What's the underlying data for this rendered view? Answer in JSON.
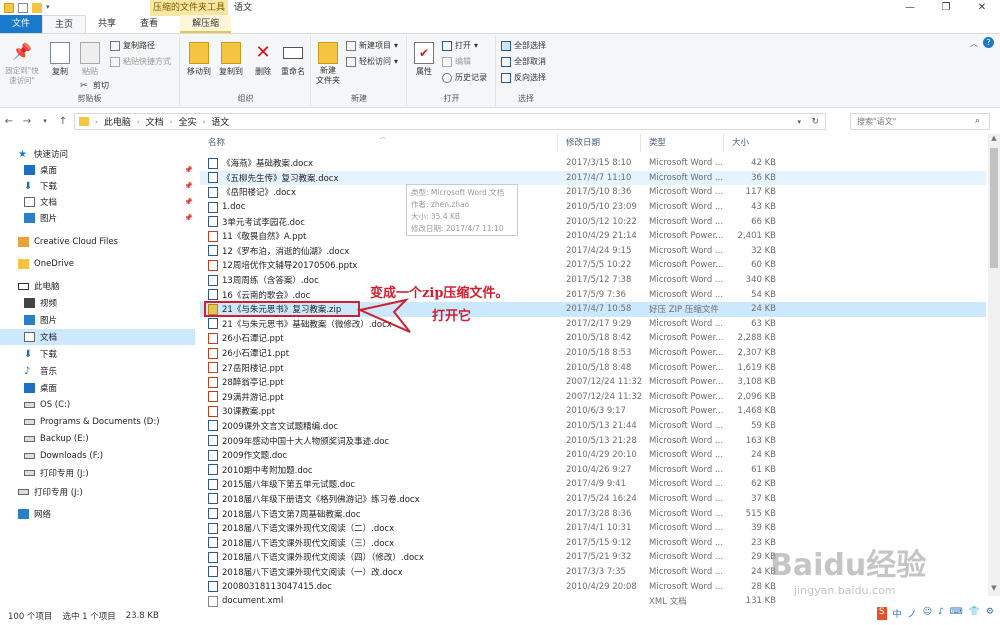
{
  "window": {
    "title": "语文",
    "context_group": "压缩的文件夹工具"
  },
  "tabs": [
    {
      "label": "文件"
    },
    {
      "label": "主页"
    },
    {
      "label": "共享"
    },
    {
      "label": "查看"
    },
    {
      "label": "解压缩"
    }
  ],
  "ribbon": {
    "clipboard": {
      "label": "剪贴板",
      "pin": "固定到\"快速访问\"",
      "copy": "复制",
      "paste": "粘贴",
      "copy_path": "复制路径",
      "paste_shortcut": "粘贴快捷方式",
      "cut": "剪切"
    },
    "organize": {
      "label": "组织",
      "move_to": "移动到",
      "copy_to": "复制到",
      "delete": "删除",
      "rename": "重命名"
    },
    "new": {
      "label": "新建",
      "new_folder": "新建\n文件夹",
      "new_item": "新建项目",
      "easy_access": "轻松访问"
    },
    "open": {
      "label": "打开",
      "properties": "属性",
      "open": "打开",
      "edit": "编辑",
      "history": "历史记录"
    },
    "select": {
      "label": "选择",
      "select_all": "全部选择",
      "select_none": "全部取消",
      "invert": "反向选择"
    }
  },
  "address": {
    "crumbs": [
      "此电脑",
      "文档",
      "全实",
      "语文"
    ],
    "search_placeholder": "搜索\"语文\""
  },
  "nav": [
    {
      "label": "快速访问",
      "icon": "star-icon",
      "pinned": false
    },
    {
      "label": "桌面",
      "icon": "desktop-icon",
      "pinned": true
    },
    {
      "label": "下载",
      "icon": "download-icon",
      "pinned": true
    },
    {
      "label": "文档",
      "icon": "documents-icon",
      "pinned": true
    },
    {
      "label": "图片",
      "icon": "pictures-icon",
      "pinned": true
    },
    {
      "label": "Creative Cloud Files",
      "icon": "creative-cloud-icon",
      "pinned": false
    },
    {
      "label": "OneDrive",
      "icon": "onedrive-icon",
      "pinned": false
    },
    {
      "label": "此电脑",
      "icon": "computer-icon",
      "pinned": false
    },
    {
      "label": "视频",
      "icon": "videos-icon",
      "pinned": false
    },
    {
      "label": "图片",
      "icon": "pictures-icon",
      "pinned": false
    },
    {
      "label": "文档",
      "icon": "documents-icon",
      "pinned": false
    },
    {
      "label": "下载",
      "icon": "download-icon",
      "pinned": false
    },
    {
      "label": "音乐",
      "icon": "music-icon",
      "pinned": false
    },
    {
      "label": "桌面",
      "icon": "desktop-icon",
      "pinned": false
    },
    {
      "label": "OS (C:)",
      "icon": "drive-icon",
      "pinned": false
    },
    {
      "label": "Programs & Documents (D:)",
      "icon": "drive-icon",
      "pinned": false
    },
    {
      "label": "Backup (E:)",
      "icon": "drive-icon",
      "pinned": false
    },
    {
      "label": "Downloads (F:)",
      "icon": "drive-icon",
      "pinned": false
    },
    {
      "label": "打印专用 (J:)",
      "icon": "drive-icon",
      "pinned": false
    },
    {
      "label": "打印专用 (J:)",
      "icon": "drive-icon",
      "pinned": false
    },
    {
      "label": "网络",
      "icon": "network-icon",
      "pinned": false
    }
  ],
  "columns": {
    "name": "名称",
    "date": "修改日期",
    "type": "类型",
    "size": "大小"
  },
  "files": [
    {
      "name": "《海燕》基础教案.docx",
      "date": "2017/3/15 8:10",
      "type": "Microsoft Word ...",
      "size": "42 KB",
      "kind": "doc"
    },
    {
      "name": "《五柳先生传》复习教案.docx",
      "date": "2017/4/7 11:10",
      "type": "Microsoft Word ...",
      "size": "36 KB",
      "kind": "doc"
    },
    {
      "name": "《岳阳楼记》.docx",
      "date": "2017/5/10 8:36",
      "type": "Microsoft Word ...",
      "size": "117 KB",
      "kind": "doc"
    },
    {
      "name": "1.doc",
      "date": "2010/5/10 23:09",
      "type": "Microsoft Word ...",
      "size": "43 KB",
      "kind": "doc"
    },
    {
      "name": "3单元考试李园花.doc",
      "date": "2010/5/12 10:22",
      "type": "Microsoft Word ...",
      "size": "66 KB",
      "kind": "doc"
    },
    {
      "name": "11《敬畏自然》A.ppt",
      "date": "2010/4/29 21:14",
      "type": "Microsoft Power...",
      "size": "2,401 KB",
      "kind": "ppt"
    },
    {
      "name": "12《罗布泊，消逝的仙湖》.docx",
      "date": "2017/4/24 9:15",
      "type": "Microsoft Word ...",
      "size": "32 KB",
      "kind": "doc"
    },
    {
      "name": "12周培优作文辅导20170506.pptx",
      "date": "2017/5/5 10:22",
      "type": "Microsoft Power...",
      "size": "60 KB",
      "kind": "ppt"
    },
    {
      "name": "13周周练（含答案）.doc",
      "date": "2017/5/12 7:38",
      "type": "Microsoft Word ...",
      "size": "340 KB",
      "kind": "doc"
    },
    {
      "name": "16《云南的歌会》.doc",
      "date": "2017/5/9 7:36",
      "type": "Microsoft Word ...",
      "size": "54 KB",
      "kind": "doc"
    },
    {
      "name": "21《与朱元思书》复习教案.zip",
      "date": "2017/4/7 10:58",
      "type": "好压 ZIP 压缩文件",
      "size": "24 KB",
      "kind": "zip"
    },
    {
      "name": "21《与朱元思书》基础教案（微修改）.docx",
      "date": "2017/2/17 9:29",
      "type": "Microsoft Word ...",
      "size": "63 KB",
      "kind": "doc"
    },
    {
      "name": "26小石潭记.ppt",
      "date": "2010/5/18 8:42",
      "type": "Microsoft Power...",
      "size": "2,288 KB",
      "kind": "ppt"
    },
    {
      "name": "26小石潭记1.ppt",
      "date": "2010/5/18 8:53",
      "type": "Microsoft Power...",
      "size": "2,307 KB",
      "kind": "ppt"
    },
    {
      "name": "27岳阳楼记.ppt",
      "date": "2010/5/18 8:48",
      "type": "Microsoft Power...",
      "size": "1,619 KB",
      "kind": "ppt"
    },
    {
      "name": "28醉翁亭记.ppt",
      "date": "2007/12/24 11:32",
      "type": "Microsoft Power...",
      "size": "3,108 KB",
      "kind": "ppt"
    },
    {
      "name": "29满井游记.ppt",
      "date": "2007/12/24 11:32",
      "type": "Microsoft Power...",
      "size": "2,096 KB",
      "kind": "ppt"
    },
    {
      "name": "30课教案.ppt",
      "date": "2010/6/3 9:17",
      "type": "Microsoft Power...",
      "size": "1,468 KB",
      "kind": "ppt"
    },
    {
      "name": "2009课外文言文试题精编.doc",
      "date": "2010/5/13 21:44",
      "type": "Microsoft Word ...",
      "size": "59 KB",
      "kind": "doc"
    },
    {
      "name": "2009年感动中国十大人物颁奖词及事迹.doc",
      "date": "2010/5/13 21:28",
      "type": "Microsoft Word ...",
      "size": "163 KB",
      "kind": "doc"
    },
    {
      "name": "2009作文题.doc",
      "date": "2010/4/29 20:10",
      "type": "Microsoft Word ...",
      "size": "24 KB",
      "kind": "doc"
    },
    {
      "name": "2010期中考附加题.doc",
      "date": "2010/4/26 9:27",
      "type": "Microsoft Word ...",
      "size": "61 KB",
      "kind": "doc"
    },
    {
      "name": "2015届八年级下第五单元试题.doc",
      "date": "2017/4/9 9:41",
      "type": "Microsoft Word ...",
      "size": "62 KB",
      "kind": "doc"
    },
    {
      "name": "2018届八年级下册语文《格列佛游记》练习卷.docx",
      "date": "2017/5/24 16:24",
      "type": "Microsoft Word ...",
      "size": "37 KB",
      "kind": "doc"
    },
    {
      "name": "2018届八下语文第7周基础教案.doc",
      "date": "2017/3/28 8:36",
      "type": "Microsoft Word ...",
      "size": "515 KB",
      "kind": "doc"
    },
    {
      "name": "2018届八下语文课外现代文阅读（二）.docx",
      "date": "2017/4/1 10:31",
      "type": "Microsoft Word ...",
      "size": "39 KB",
      "kind": "doc"
    },
    {
      "name": "2018届八下语文课外现代文阅读（三）.docx",
      "date": "2017/5/15 9:12",
      "type": "Microsoft Word ...",
      "size": "23 KB",
      "kind": "doc"
    },
    {
      "name": "2018届八下语文课外现代文阅读（四）（修改）.docx",
      "date": "2017/5/21 9:32",
      "type": "Microsoft Word ...",
      "size": "29 KB",
      "kind": "doc"
    },
    {
      "name": "2018届八下语文课外现代文阅读（一）改.docx",
      "date": "2017/3/3 7:35",
      "type": "Microsoft Word ...",
      "size": "24 KB",
      "kind": "doc"
    },
    {
      "name": "20080318113047415.doc",
      "date": "2010/4/29 20:08",
      "type": "Microsoft Word ...",
      "size": "28 KB",
      "kind": "doc"
    },
    {
      "name": "document.xml",
      "date": "",
      "type": "XML 文档",
      "size": "131 KB",
      "kind": "xml"
    }
  ],
  "tooltip": {
    "type": "类型: Microsoft Word 文档",
    "author": "作者: zhen.zhao",
    "size": "大小: 35.4 KB",
    "modified": "修改日期: 2017/4/7 11:10"
  },
  "annotation": {
    "main": "变成一个zip压缩文件。",
    "sub": "打开它"
  },
  "status": {
    "count": "100 个项目",
    "selected": "选中 1 个项目",
    "size": "23.8 KB"
  },
  "watermark": {
    "brand": "Baidu经验",
    "url": "jingyan.baidu.com"
  },
  "ime": [
    "S",
    "中",
    "ノ",
    "☺",
    "♪",
    "⌨",
    "👕",
    "⚙"
  ]
}
